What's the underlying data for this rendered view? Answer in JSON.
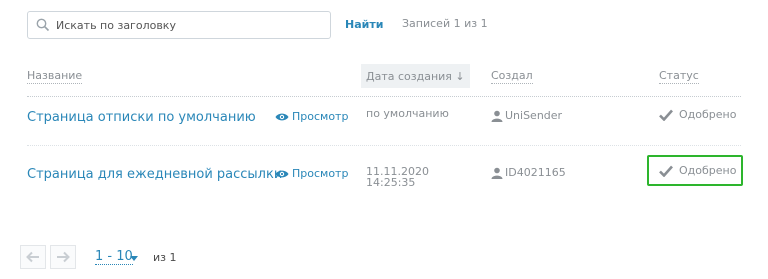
{
  "search": {
    "placeholder": "Искать по заголовку",
    "find_label": "Найти",
    "records_count": "Записей 1 из 1"
  },
  "table": {
    "headers": {
      "name": "Название",
      "date": "Дата создания ↓",
      "creator": "Создал",
      "status": "Статус"
    },
    "rows": [
      {
        "title": "Страница отписки по умолчанию",
        "preview": "Просмотр",
        "date": "по умолчанию",
        "time": "",
        "creator": "UniSender",
        "status": "Одобрено"
      },
      {
        "title": "Страница для ежедневной рассылки",
        "preview": "Просмотр",
        "date": "11.11.2020",
        "time": "14:25:35",
        "creator": "ID4021165",
        "status": "Одобрено"
      }
    ]
  },
  "pagination": {
    "range": "1 - 10",
    "of": "из 1"
  },
  "icons": {
    "search": "search-icon",
    "eye": "eye-icon",
    "user": "user-icon",
    "check": "check-icon",
    "prev": "arrow-left-icon",
    "next": "arrow-right-icon",
    "caret": "caret-down-icon"
  },
  "colors": {
    "link": "#2a87b8",
    "muted": "#8a8f94",
    "highlight": "#2db52d"
  }
}
